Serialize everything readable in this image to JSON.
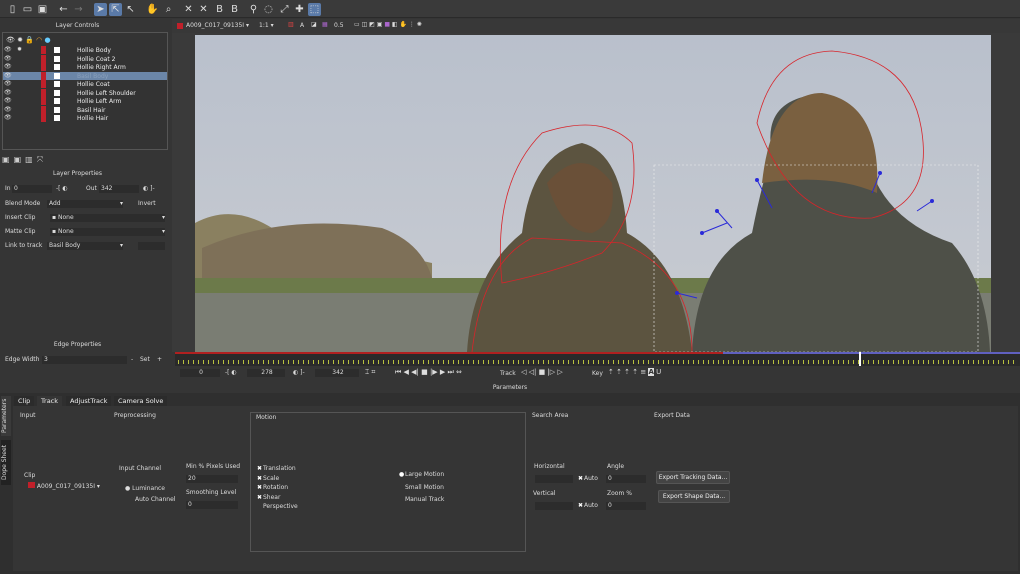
{
  "colors": {
    "accent": "#5a7aa8",
    "layer_color": "#c0202a",
    "spline": "#d8242a",
    "track_point": "#2a2ad8"
  },
  "toolbar": {
    "icons": [
      "new-file-icon",
      "open-folder-icon",
      "save-icon",
      "undo-icon",
      "redo-icon",
      "select-arrow-icon",
      "select-points-icon",
      "add-point-icon",
      "hand-pan-icon",
      "zoom-icon",
      "xspline-icon",
      "xspline-add-icon",
      "bspline-icon",
      "bspline-add-icon",
      "link-icon",
      "lasso-icon",
      "transform-icon",
      "move-cross-icon",
      "surface-icon"
    ]
  },
  "layer_controls": {
    "title": "Layer Controls",
    "layers": [
      {
        "name": "Hollie Body",
        "selected": false
      },
      {
        "name": "Hollie Coat 2",
        "selected": false
      },
      {
        "name": "Hollie Right Arm",
        "selected": false
      },
      {
        "name": "Basil Body",
        "selected": true
      },
      {
        "name": "Hollie Coat",
        "selected": false
      },
      {
        "name": "Hollie Left Shoulder",
        "selected": false
      },
      {
        "name": "Hollie Left Arm",
        "selected": false
      },
      {
        "name": "Basil Hair",
        "selected": false
      },
      {
        "name": "Hollie Hair",
        "selected": false
      }
    ]
  },
  "layer_properties": {
    "title": "Layer Properties",
    "in_label": "In",
    "in_value": "0",
    "out_label": "Out",
    "out_value": "342",
    "blend_mode_label": "Blend Mode",
    "blend_mode_value": "Add",
    "invert_label": "Invert",
    "insert_clip_label": "Insert Clip",
    "insert_clip_value": "None",
    "matte_clip_label": "Matte Clip",
    "matte_clip_value": "None",
    "link_label": "Link to track",
    "link_value": "Basil Body"
  },
  "edge_properties": {
    "title": "Edge Properties",
    "edge_width_label": "Edge Width",
    "edge_width_value": "3",
    "minus": "-",
    "set": "Set",
    "plus": "+"
  },
  "viewer": {
    "clip": "A009_C017_09135I",
    "zoom": "1:1",
    "channel": "A",
    "opacity": "0.5"
  },
  "timeline": {
    "start": "0",
    "in": "278",
    "out": "342",
    "track_label": "Track",
    "key_label": "Key",
    "playhead_fraction": 0.8
  },
  "parameters": {
    "title": "Parameters",
    "side_tabs": [
      "Parameters",
      "Dope Sheet"
    ],
    "tabs": [
      "Clip",
      "Track",
      "AdjustTrack",
      "Camera Solve"
    ],
    "active_tab": "Track",
    "input": {
      "title": "Input",
      "clip_label": "Clip",
      "clip_value": "A009_C017_09135I"
    },
    "preprocessing": {
      "title": "Preprocessing",
      "channel_label": "Input Channel",
      "luminance": "Luminance",
      "auto_channel": "Auto Channel",
      "min_pixels_label": "Min % Pixels Used",
      "min_pixels_value": "20",
      "smoothing_label": "Smoothing Level",
      "smoothing_value": "0"
    },
    "motion": {
      "title": "Motion",
      "options": [
        {
          "label": "Translation",
          "checked": true
        },
        {
          "label": "Scale",
          "checked": true
        },
        {
          "label": "Rotation",
          "checked": true
        },
        {
          "label": "Shear",
          "checked": true
        },
        {
          "label": "Perspective",
          "checked": false
        }
      ],
      "modes": [
        {
          "label": "Large Motion",
          "selected": true
        },
        {
          "label": "Small Motion",
          "selected": false
        },
        {
          "label": "Manual Track",
          "selected": false
        }
      ]
    },
    "search_area": {
      "title": "Search Area",
      "horizontal": "Horizontal",
      "vertical": "Vertical",
      "auto": "Auto",
      "angle_label": "Angle",
      "angle_value": "0",
      "zoom_label": "Zoom %",
      "zoom_value": "0"
    },
    "export": {
      "title": "Export Data",
      "tracking": "Export Tracking Data...",
      "shape": "Export Shape Data..."
    }
  }
}
